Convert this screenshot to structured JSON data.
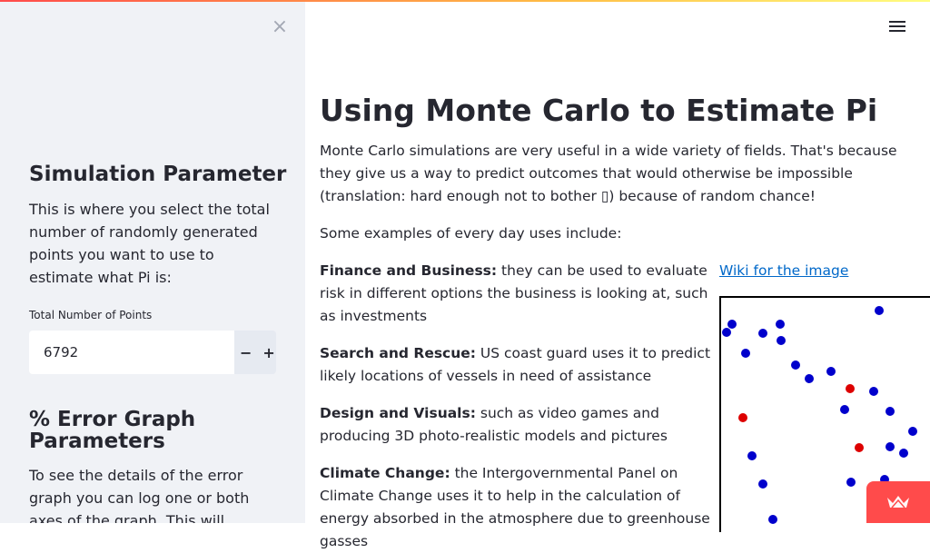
{
  "sidebar": {
    "close_glyph": "×",
    "section1_title": "Simulation Parameter",
    "section1_text": "This is where you select the total number of randomly generated points you want to use to estimate what Pi is:",
    "input_label": "Total Number of Points",
    "input_value": "6792",
    "minus_label": "−",
    "plus_label": "+",
    "section2_title": "% Error Graph Parameters",
    "section2_text": "To see the details of the error graph you can log one or both axes of the graph. This will display the order of"
  },
  "main": {
    "title": "Using Monte Carlo to Estimate Pi",
    "intro": "Monte Carlo simulations are very useful in a wide variety of fields. That's because they give us a way to predict outcomes that would otherwise be impossible (translation: hard enough not to bother ▯) because of random chance!",
    "examples_intro": "Some examples of every day uses include:",
    "examples": [
      {
        "label": "Finance and Business:",
        "text": " they can be used to evaluate risk in different options the business is looking at, such as investments"
      },
      {
        "label": "Search and Rescue:",
        "text": " US coast guard uses it to predict likely locations of vessels in need of assistance"
      },
      {
        "label": "Design and Visuals:",
        "text": " such as video games and producing 3D photo-realistic models and pictures"
      },
      {
        "label": "Climate Change:",
        "text": " the Intergovernmental Panel on Climate Change uses it to help in the calculation of energy absorbed in the atmosphere due to greenhouse gasses"
      }
    ],
    "wiki_link": "Wiki for the image"
  },
  "colors": {
    "accent": "#ff4b4b",
    "link": "#0068c9",
    "blue_point": "#0000cc",
    "red_point": "#dd0000"
  },
  "icons": {
    "menu": "hamburger-menu-icon",
    "close": "close-icon",
    "badge": "streamlit-crown-icon"
  }
}
